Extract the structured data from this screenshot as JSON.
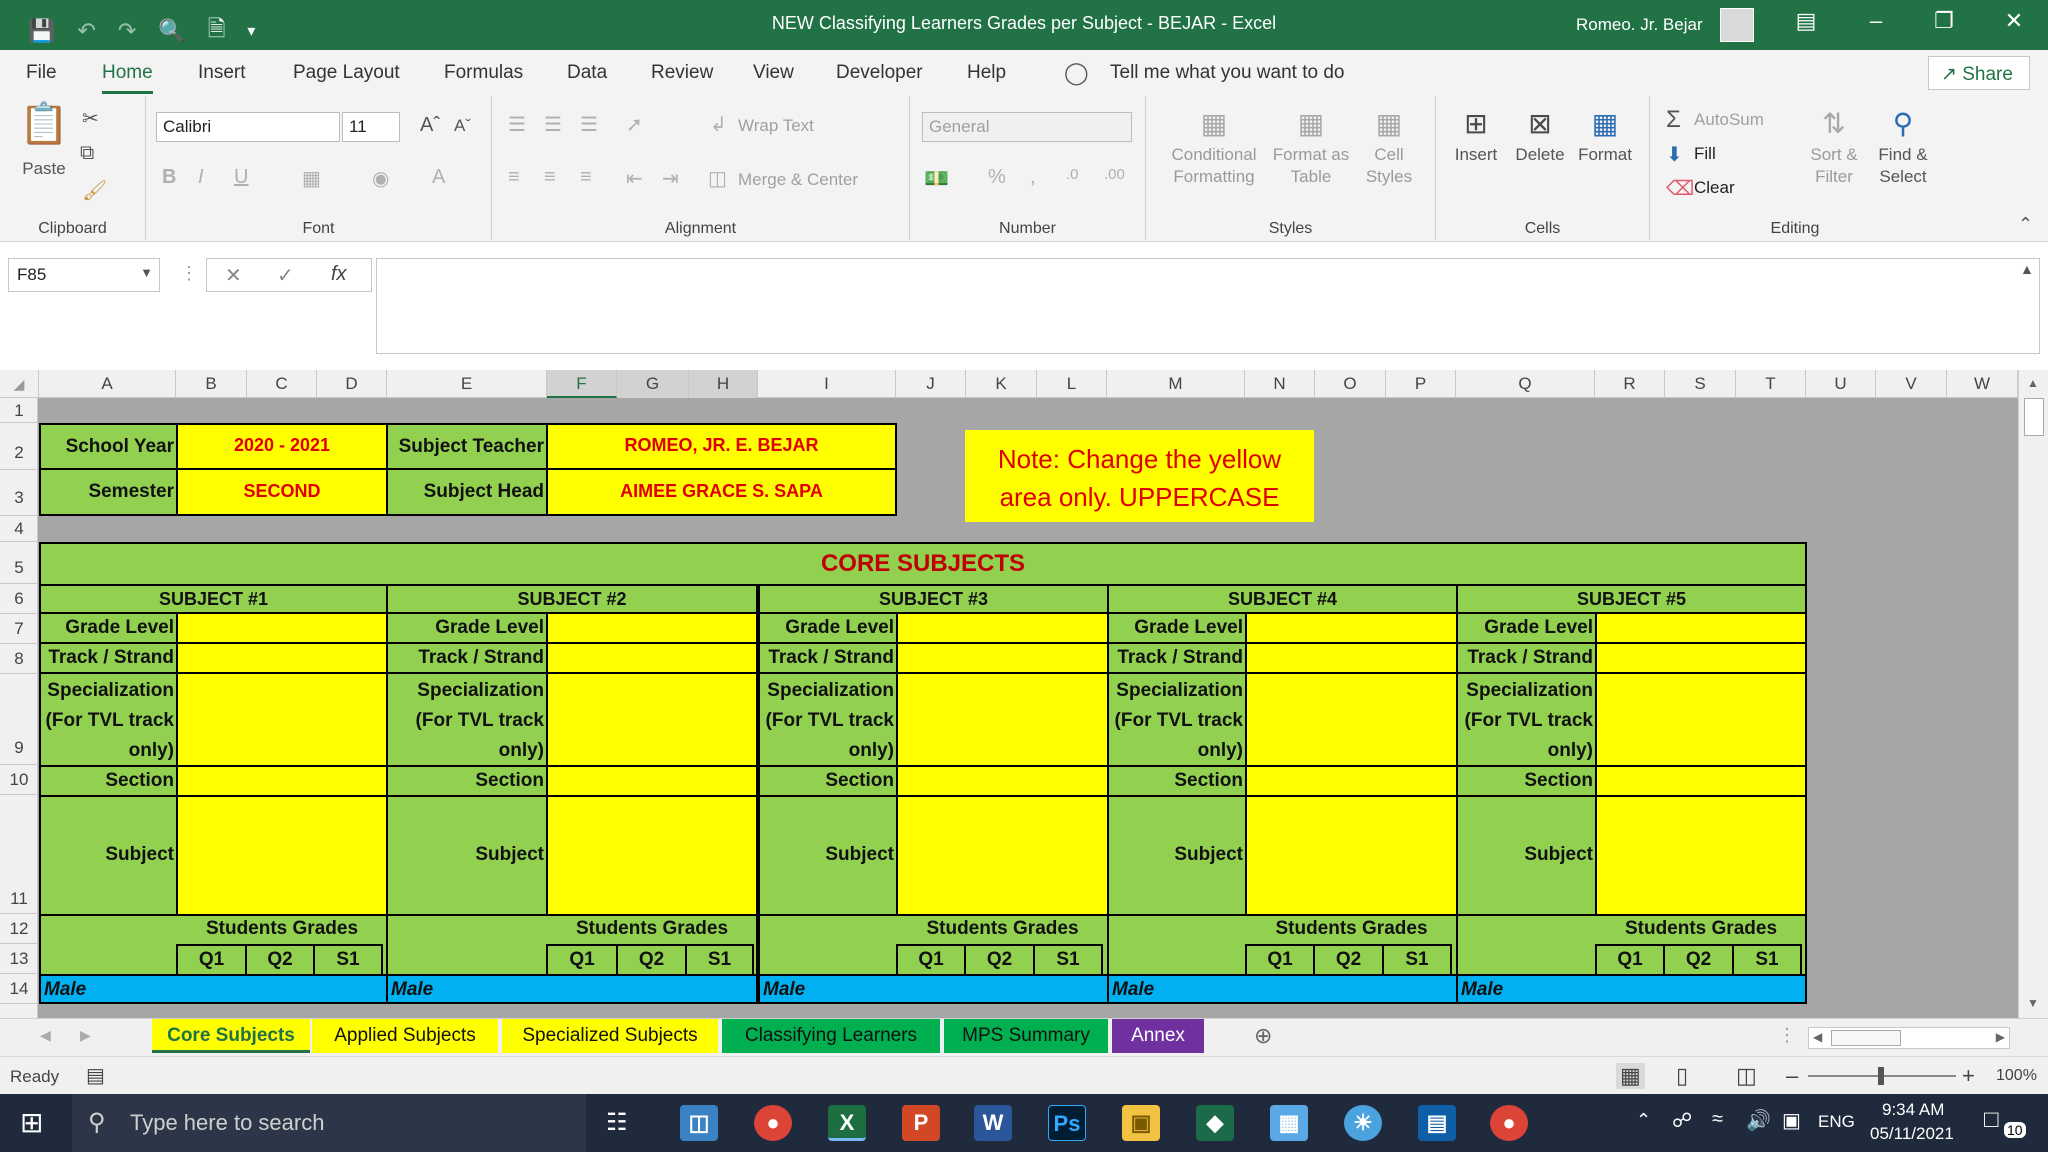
{
  "window": {
    "title": "NEW Classifying Learners Grades per Subject - BEJAR  -  Excel",
    "user": "Romeo. Jr. Bejar"
  },
  "menu": {
    "tabs": [
      "File",
      "Home",
      "Insert",
      "Page Layout",
      "Formulas",
      "Data",
      "Review",
      "View",
      "Developer",
      "Help"
    ],
    "tell_me": "Tell me what you want to do",
    "share": "Share"
  },
  "ribbon": {
    "clipboard": {
      "label": "Clipboard",
      "paste": "Paste"
    },
    "font": {
      "label": "Font",
      "name": "Calibri",
      "size": "11"
    },
    "alignment": {
      "label": "Alignment",
      "wrap_text": "Wrap Text",
      "merge_center": "Merge & Center"
    },
    "number": {
      "label": "Number",
      "format": "General"
    },
    "styles": {
      "label": "Styles",
      "conditional": [
        "Conditional",
        "Formatting"
      ],
      "format_table": [
        "Format as",
        "Table"
      ],
      "cell_styles": [
        "Cell",
        "Styles"
      ]
    },
    "cells": {
      "label": "Cells",
      "insert": "Insert",
      "delete": "Delete",
      "format": "Format"
    },
    "editing": {
      "label": "Editing",
      "autosum": "AutoSum",
      "fill": "Fill",
      "clear": "Clear",
      "sort": [
        "Sort &",
        "Filter"
      ],
      "find": [
        "Find &",
        "Select"
      ]
    }
  },
  "formula_bar": {
    "name_box": "F85",
    "fx": "fx",
    "value": ""
  },
  "columns": [
    "A",
    "B",
    "C",
    "D",
    "E",
    "F",
    "G",
    "H",
    "I",
    "J",
    "K",
    "L",
    "M",
    "N",
    "O",
    "P",
    "Q",
    "R",
    "S",
    "T",
    "U",
    "V",
    "W"
  ],
  "rows": [
    "1",
    "2",
    "3",
    "4",
    "5",
    "6",
    "7",
    "8",
    "9",
    "10",
    "11",
    "12",
    "13",
    "14"
  ],
  "header_block": {
    "school_year_label": "School Year",
    "school_year": "2020 - 2021",
    "semester_label": "Semester",
    "semester": "SECOND",
    "subject_teacher_label": "Subject Teacher",
    "subject_teacher": "ROMEO, JR. E. BEJAR",
    "subject_head_label": "Subject Head",
    "subject_head": "AIMEE GRACE S. SAPA",
    "note_line1": "Note: Change the yellow",
    "note_line2": "area only. UPPERCASE"
  },
  "core_title": "CORE SUBJECTS",
  "subjects": [
    {
      "title": "SUBJECT #1"
    },
    {
      "title": "SUBJECT #2"
    },
    {
      "title": "SUBJECT #3"
    },
    {
      "title": "SUBJECT #4"
    },
    {
      "title": "SUBJECT #5"
    }
  ],
  "subject_fields": {
    "grade_level": "Grade Level",
    "track": "Track / Strand",
    "spec1": "Specialization",
    "spec2": "(For TVL track",
    "spec3": "only)",
    "section": "Section",
    "subject": "Subject",
    "students_grades": "Students Grades",
    "q1": "Q1",
    "q2": "Q2",
    "s1": "S1",
    "male": "Male"
  },
  "sheet_tabs": [
    "Core Subjects",
    "Applied Subjects",
    "Specialized Subjects",
    "Classifying Learners",
    "MPS Summary",
    "Annex"
  ],
  "status": {
    "ready": "Ready",
    "zoom": "100%"
  },
  "taskbar": {
    "search": "Type here to search",
    "lang": "ENG",
    "time": "9:34 AM",
    "date": "05/11/2021",
    "notifications": "10"
  }
}
